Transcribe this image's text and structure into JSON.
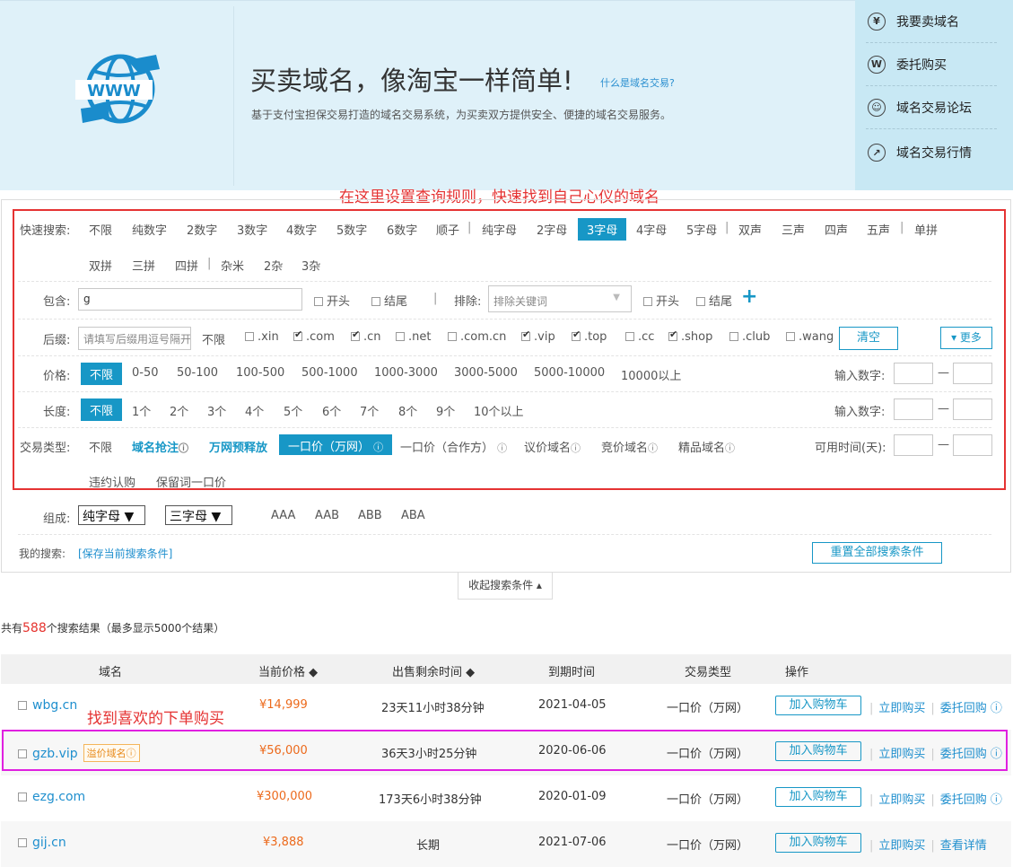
{
  "banner": {
    "headline": "买卖域名，像淘宝一样简单!",
    "what_link": "什么是域名交易?",
    "subline": "基于支付宝担保交易打造的域名交易系统，为买卖双方提供安全、便捷的域名交易服务。",
    "logo_text": "WWW"
  },
  "side_menu": [
    {
      "icon": "yen-icon",
      "glyph": "¥",
      "label": "我要卖域名"
    },
    {
      "icon": "w-icon",
      "glyph": "W",
      "label": "委托购买"
    },
    {
      "icon": "person-icon",
      "glyph": "☺",
      "label": "域名交易论坛"
    },
    {
      "icon": "trend-icon",
      "glyph": "↗",
      "label": "域名交易行情"
    }
  ],
  "annotation_top": "在这里设置查询规则，快速找到自己心仪的域名",
  "annotation_buy": "找到喜欢的下单购买",
  "quick_search": {
    "label": "快速搜索:",
    "row1": [
      "不限",
      "纯数字",
      "2数字",
      "3数字",
      "4数字",
      "5数字",
      "6数字",
      "顺子",
      "|",
      "纯字母",
      "2字母",
      "3字母",
      "4字母",
      "5字母",
      "|",
      "双声",
      "三声",
      "四声",
      "五声",
      "|",
      "单拼"
    ],
    "row2": [
      "双拼",
      "三拼",
      "四拼",
      "|",
      "杂米",
      "2杂",
      "3杂"
    ],
    "selected": "3字母"
  },
  "contains": {
    "label": "包含:",
    "value": "g",
    "start": "开头",
    "end": "结尾",
    "sep": "|",
    "exclude_label": "排除:",
    "exclude_placeholder": "排除关键词",
    "start2": "开头",
    "end2": "结尾",
    "plus": "+"
  },
  "suffix": {
    "label": "后缀:",
    "placeholder": "请填写后缀用逗号隔开",
    "any": "不限",
    "items": [
      {
        "name": ".xin",
        "checked": false
      },
      {
        "name": ".com",
        "checked": true
      },
      {
        "name": ".cn",
        "checked": true
      },
      {
        "name": ".net",
        "checked": false
      },
      {
        "name": ".com.cn",
        "checked": false
      },
      {
        "name": ".vip",
        "checked": true
      },
      {
        "name": ".top",
        "checked": true
      },
      {
        "name": ".cc",
        "checked": false
      },
      {
        "name": ".shop",
        "checked": true
      },
      {
        "name": ".club",
        "checked": false
      },
      {
        "name": ".wang",
        "checked": false
      }
    ],
    "clear": "清空",
    "more": "▾ 更多"
  },
  "price": {
    "label": "价格:",
    "options": [
      "不限",
      "0-50",
      "50-100",
      "100-500",
      "500-1000",
      "1000-3000",
      "3000-5000",
      "5000-10000",
      "10000以上"
    ],
    "input_label": "输入数字:",
    "dash": "—"
  },
  "length": {
    "label": "长度:",
    "options": [
      "不限",
      "1个",
      "2个",
      "3个",
      "4个",
      "5个",
      "6个",
      "7个",
      "8个",
      "9个",
      "10个以上"
    ],
    "input_label": "输入数字:",
    "dash": "—"
  },
  "trade_type": {
    "label": "交易类型:",
    "any": "不限",
    "snatch": "域名抢注",
    "prereg": "万网预释放",
    "fixed_wanwang": "一口价（万网）",
    "fixed_partner": "一口价（合作方）",
    "negotiable": "议价域名",
    "auction": "竞价域名",
    "premium": "精品域名",
    "violation": "违约认购",
    "reserved": "保留词一口价",
    "avail_label": "可用时间(天):",
    "dash": "—",
    "help": "?"
  },
  "compose": {
    "label": "组成:",
    "dd1": "纯字母 ▼",
    "dd2": "三字母 ▼",
    "patterns": [
      "AAA",
      "AAB",
      "ABB",
      "ABA"
    ]
  },
  "my_search": {
    "label": "我的搜索:",
    "save_link": "[保存当前搜索条件]",
    "reset": "重置全部搜索条件"
  },
  "collapse": "收起搜索条件 ▴",
  "results": {
    "prefix": "共有",
    "count": "588",
    "suffix": "个搜索结果（最多显示5000个结果）"
  },
  "table": {
    "headers": [
      "域名",
      "当前价格 ◆",
      "出售剩余时间 ◆",
      "到期时间",
      "交易类型",
      "操作"
    ],
    "rows": [
      {
        "domain": "wbg.cn",
        "tag": "",
        "price": "¥14,999",
        "remain": "23天11小时38分钟",
        "expire": "2021-04-05",
        "type": "一口价（万网）",
        "cart": "加入购物车",
        "buy": "立即购买",
        "extra": "委托回购 ⓘ"
      },
      {
        "domain": "gzb.vip",
        "tag": "溢价域名ⓘ",
        "price": "¥56,000",
        "remain": "36天3小时25分钟",
        "expire": "2020-06-06",
        "type": "一口价（万网）",
        "cart": "加入购物车",
        "buy": "立即购买",
        "extra": "委托回购 ⓘ"
      },
      {
        "domain": "ezg.com",
        "tag": "",
        "price": "¥300,000",
        "remain": "173天6小时38分钟",
        "expire": "2020-01-09",
        "type": "一口价（万网）",
        "cart": "加入购物车",
        "buy": "立即购买",
        "extra": "委托回购 ⓘ"
      },
      {
        "domain": "gij.cn",
        "tag": "",
        "price": "¥3,888",
        "remain": "长期",
        "expire": "2021-07-06",
        "type": "一口价（万网）",
        "cart": "加入购物车",
        "buy": "立即购买",
        "extra": "查看详情"
      }
    ]
  }
}
